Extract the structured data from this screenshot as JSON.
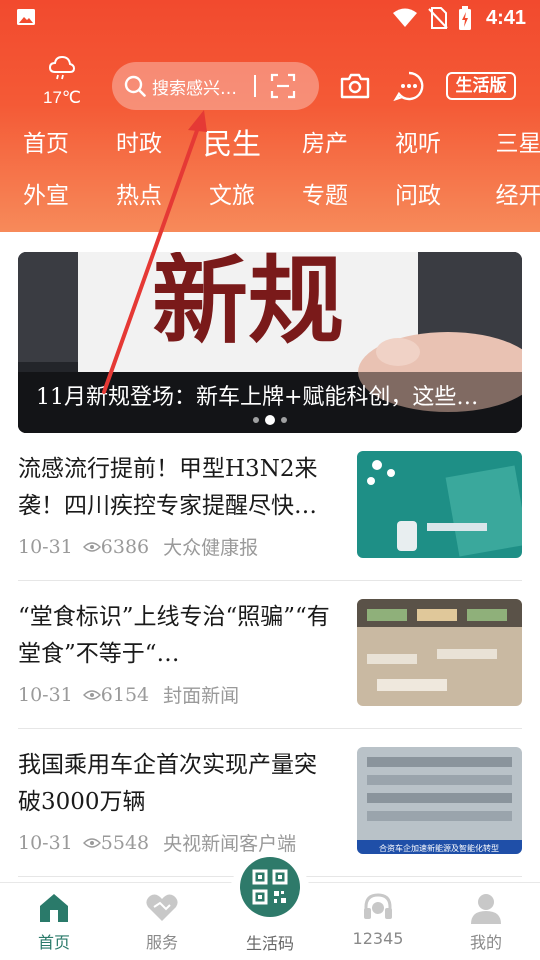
{
  "status_bar": {
    "time": "4:41"
  },
  "weather": {
    "temp": "17℃"
  },
  "search": {
    "placeholder": "搜索感兴…"
  },
  "header": {
    "life_button": "生活版"
  },
  "nav": {
    "row1": [
      "首页",
      "时政",
      "民生",
      "房产",
      "视听",
      "三星堆"
    ],
    "row2": [
      "外宣",
      "热点",
      "文旅",
      "专题",
      "问政",
      "经开区"
    ],
    "active": "民生"
  },
  "banner": {
    "sign_text": "新规",
    "title": "11月新规登场：新车上牌+赋能科创，这些…",
    "page": 2,
    "total": 3
  },
  "news": [
    {
      "title": "流感流行提前！甲型H3N2来袭！四川疾控专家提醒尽快…",
      "date": "10-31",
      "views": "6386",
      "source": "大众健康报"
    },
    {
      "title": "“堂食标识”上线专治“照骗”“有堂食”不等于“…",
      "date": "10-31",
      "views": "6154",
      "source": "封面新闻"
    },
    {
      "title": "我国乘用车企首次实现产量突破3000万辆",
      "date": "10-31",
      "views": "5548",
      "source": "央视新闻客户端",
      "thumb_caption": "合资车企加速新能源及智能化转型"
    }
  ],
  "tabbar": {
    "items": [
      "首页",
      "服务",
      "生活码",
      "12345",
      "我的"
    ],
    "active": "首页"
  },
  "colors": {
    "header_red": "#f24a2e",
    "accent_green": "#2a7a6a",
    "annotation_arrow": "#e53935"
  }
}
